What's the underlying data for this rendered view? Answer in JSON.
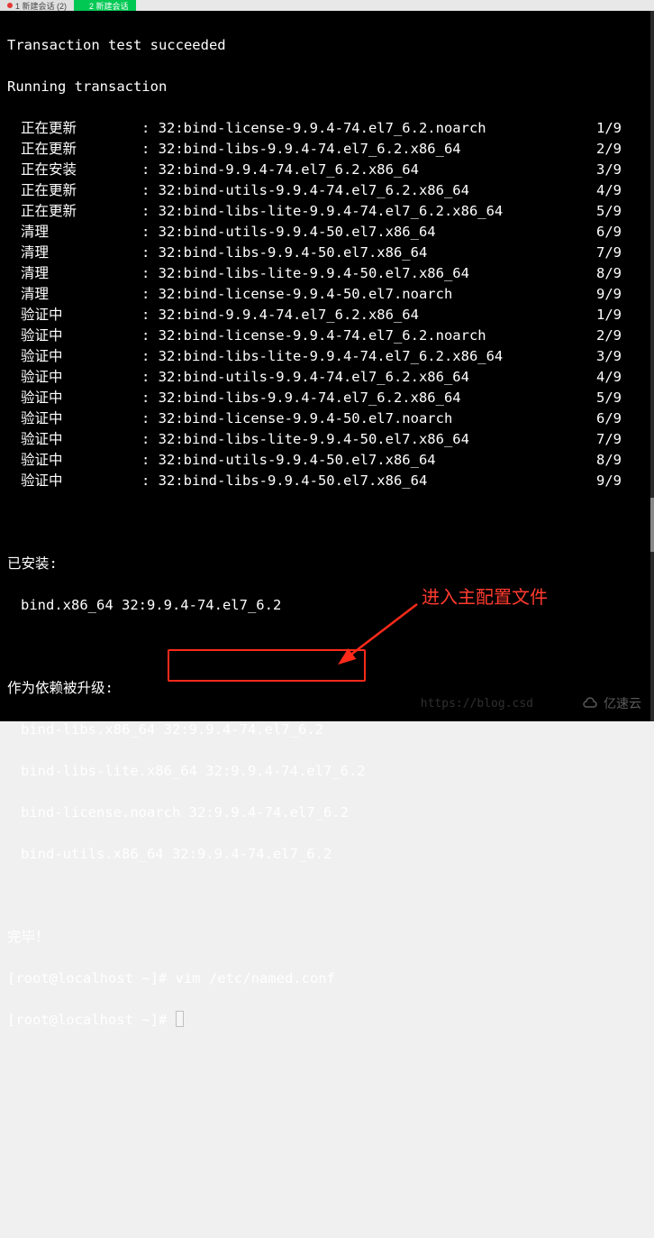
{
  "tabs": {
    "t1": "1 新建会话 (2)",
    "t2": "2 新建会话"
  },
  "header": {
    "l1": "Transaction test succeeded",
    "l2": "Running transaction"
  },
  "rows": [
    {
      "status": "正在更新",
      "pkg": ": 32:bind-license-9.9.4-74.el7_6.2.noarch",
      "count": "1/9"
    },
    {
      "status": "正在更新",
      "pkg": ": 32:bind-libs-9.9.4-74.el7_6.2.x86_64",
      "count": "2/9"
    },
    {
      "status": "正在安装",
      "pkg": ": 32:bind-9.9.4-74.el7_6.2.x86_64",
      "count": "3/9"
    },
    {
      "status": "正在更新",
      "pkg": ": 32:bind-utils-9.9.4-74.el7_6.2.x86_64",
      "count": "4/9"
    },
    {
      "status": "正在更新",
      "pkg": ": 32:bind-libs-lite-9.9.4-74.el7_6.2.x86_64",
      "count": "5/9"
    },
    {
      "status": "清理",
      "pkg": ": 32:bind-utils-9.9.4-50.el7.x86_64",
      "count": "6/9"
    },
    {
      "status": "清理",
      "pkg": ": 32:bind-libs-9.9.4-50.el7.x86_64",
      "count": "7/9"
    },
    {
      "status": "清理",
      "pkg": ": 32:bind-libs-lite-9.9.4-50.el7.x86_64",
      "count": "8/9"
    },
    {
      "status": "清理",
      "pkg": ": 32:bind-license-9.9.4-50.el7.noarch",
      "count": "9/9"
    },
    {
      "status": "验证中",
      "pkg": ": 32:bind-9.9.4-74.el7_6.2.x86_64",
      "count": "1/9"
    },
    {
      "status": "验证中",
      "pkg": ": 32:bind-license-9.9.4-74.el7_6.2.noarch",
      "count": "2/9"
    },
    {
      "status": "验证中",
      "pkg": ": 32:bind-libs-lite-9.9.4-74.el7_6.2.x86_64",
      "count": "3/9"
    },
    {
      "status": "验证中",
      "pkg": ": 32:bind-utils-9.9.4-74.el7_6.2.x86_64",
      "count": "4/9"
    },
    {
      "status": "验证中",
      "pkg": ": 32:bind-libs-9.9.4-74.el7_6.2.x86_64",
      "count": "5/9"
    },
    {
      "status": "验证中",
      "pkg": ": 32:bind-license-9.9.4-50.el7.noarch",
      "count": "6/9"
    },
    {
      "status": "验证中",
      "pkg": ": 32:bind-libs-lite-9.9.4-50.el7.x86_64",
      "count": "7/9"
    },
    {
      "status": "验证中",
      "pkg": ": 32:bind-utils-9.9.4-50.el7.x86_64",
      "count": "8/9"
    },
    {
      "status": "验证中",
      "pkg": ": 32:bind-libs-9.9.4-50.el7.x86_64",
      "count": "9/9"
    }
  ],
  "sections": {
    "installed_header": "已安装:",
    "installed_pkg": "bind.x86_64 32:9.9.4-74.el7_6.2",
    "upgraded_header": "作为依赖被升级:",
    "upgraded_pkgs": [
      "bind-libs.x86_64 32:9.9.4-74.el7_6.2",
      "bind-libs-lite.x86_64 32:9.9.4-74.el7_6.2",
      "bind-license.noarch 32:9.9.4-74.el7_6.2",
      "bind-utils.x86_64 32:9.9.4-74.el7_6.2"
    ],
    "done": "完毕！"
  },
  "prompts": {
    "p1_prefix": "[root@localhost ~]# ",
    "p1_cmd": "vim /etc/named.conf",
    "p2": "[root@localhost ~]# "
  },
  "annotation": "进入主配置文件",
  "watermark": {
    "url": "https://blog.csd",
    "brand": "亿速云"
  }
}
